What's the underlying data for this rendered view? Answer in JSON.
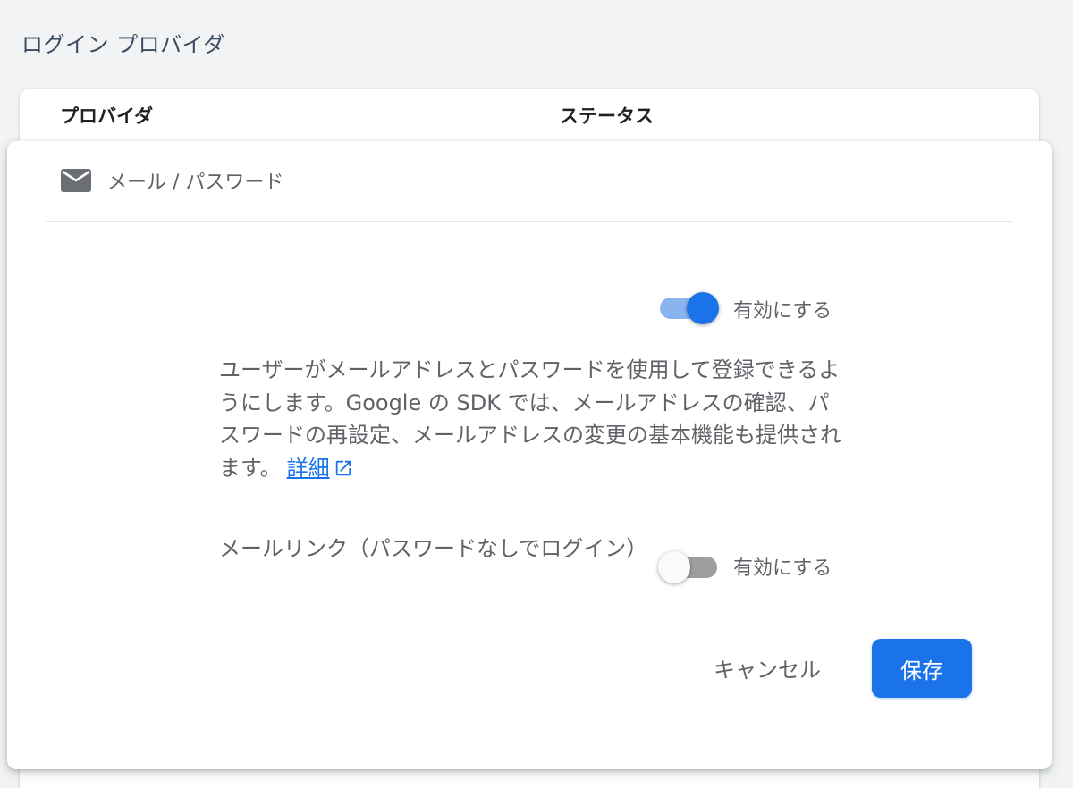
{
  "section_title": "ログイン プロバイダ",
  "table": {
    "columns": [
      "プロバイダ",
      "ステータス"
    ]
  },
  "provider": {
    "name": "メール / パスワード",
    "icon": "mail-icon"
  },
  "enable_toggle": {
    "label": "有効にする",
    "state": "on"
  },
  "description": {
    "text": "ユーザーがメールアドレスとパスワードを使用して登録できるようにします。Google の SDK では、メールアドレスの確認、パスワードの再設定、メールアドレスの変更の基本機能も提供されます。",
    "link_label": "詳細",
    "link_icon": "open-in-new-icon"
  },
  "email_link": {
    "label": "メールリンク（パスワードなしでログイン）",
    "toggle_label": "有効にする",
    "state": "off"
  },
  "actions": {
    "cancel_label": "キャンセル",
    "save_label": "保存"
  },
  "colors": {
    "accent": "#1a73e8",
    "toggle_track_on": "#8ab4f0",
    "toggle_track_off": "#9e9e9e",
    "text_secondary": "#5f6368",
    "background": "#f1f3f4"
  }
}
